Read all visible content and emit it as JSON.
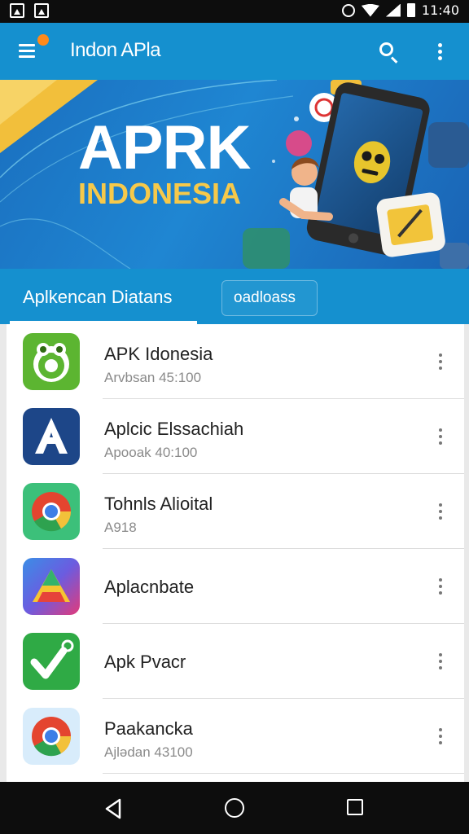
{
  "status_bar": {
    "time": "11:40"
  },
  "app_bar": {
    "title": "Indon APla"
  },
  "banner": {
    "title": "APRK",
    "subtitle": "INDONESIA"
  },
  "tabs": [
    {
      "label": "Aplkencan Diatans",
      "active": true
    },
    {
      "label": "oadloass",
      "active": false
    }
  ],
  "apps": [
    {
      "name": "APK Idonesia",
      "subtitle": "Arvbsan 45:100",
      "icon": "frog-icon"
    },
    {
      "name": "Aplcic Elssachiah",
      "subtitle": "Apooak 40:100",
      "icon": "letter-a-icon"
    },
    {
      "name": "Tohnls Alioital",
      "subtitle": "A918",
      "icon": "chrome-icon"
    },
    {
      "name": "Aplacnbate",
      "subtitle": "",
      "icon": "play-triangle-icon"
    },
    {
      "name": "Apk Pvacr",
      "subtitle": "",
      "icon": "checkmark-icon"
    },
    {
      "name": "Paakancka",
      "subtitle": "Ajlədan 43100",
      "icon": "chrome-icon"
    }
  ],
  "colors": {
    "primary": "#1590cf",
    "accent": "#ff8a1a",
    "banner_gold": "#f6c94a"
  }
}
